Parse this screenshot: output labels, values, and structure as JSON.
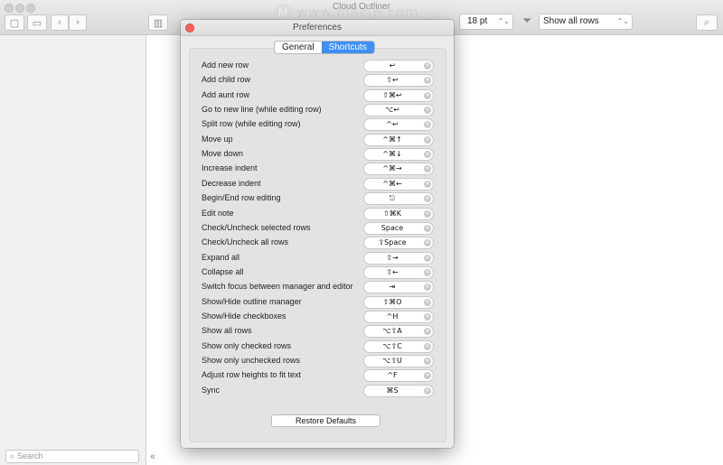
{
  "window": {
    "title": "Cloud Outliner",
    "watermark": "www.macjb.com",
    "watermark_logo": "M"
  },
  "toolbar": {
    "font_size": "18 pt",
    "row_filter": "Show all rows"
  },
  "sidebar": {
    "search_placeholder": "Search"
  },
  "preferences": {
    "title": "Preferences",
    "tabs": [
      {
        "label": "General",
        "active": false
      },
      {
        "label": "Shortcuts",
        "active": true
      }
    ],
    "shortcuts": [
      {
        "label": "Add new row",
        "key": "↩"
      },
      {
        "label": "Add child row",
        "key": "⇧↩"
      },
      {
        "label": "Add aunt row",
        "key": "⇧⌘↩"
      },
      {
        "label": "Go to new line (while editing row)",
        "key": "⌥↩"
      },
      {
        "label": "Split row (while editing row)",
        "key": "^↩"
      },
      {
        "label": "Move up",
        "key": "^⌘↑"
      },
      {
        "label": "Move down",
        "key": "^⌘↓"
      },
      {
        "label": "Increase indent",
        "key": "^⌘→"
      },
      {
        "label": "Decrease indent",
        "key": "^⌘←"
      },
      {
        "label": "Begin/End row editing",
        "key": "⎋"
      },
      {
        "label": "Edit note",
        "key": "⇧⌘K"
      },
      {
        "label": "Check/Uncheck selected rows",
        "key": "Space"
      },
      {
        "label": "Check/Uncheck all rows",
        "key": "⇧Space"
      },
      {
        "label": "Expand all",
        "key": "⇧→"
      },
      {
        "label": "Collapse all",
        "key": "⇧←"
      },
      {
        "label": "Switch focus between manager and editor",
        "key": "⇥"
      },
      {
        "label": "Show/Hide outline manager",
        "key": "⇧⌘O"
      },
      {
        "label": "Show/Hide checkboxes",
        "key": "^H"
      },
      {
        "label": "Show all rows",
        "key": "⌥⇧A"
      },
      {
        "label": "Show only checked rows",
        "key": "⌥⇧C"
      },
      {
        "label": "Show only unchecked rows",
        "key": "⌥⇧U"
      },
      {
        "label": "Adjust row heights to fit text",
        "key": "^F"
      },
      {
        "label": "Sync",
        "key": "⌘S"
      }
    ],
    "restore_label": "Restore Defaults"
  },
  "colors": {
    "accent": "#3f8ff7",
    "close": "#fc605c"
  }
}
